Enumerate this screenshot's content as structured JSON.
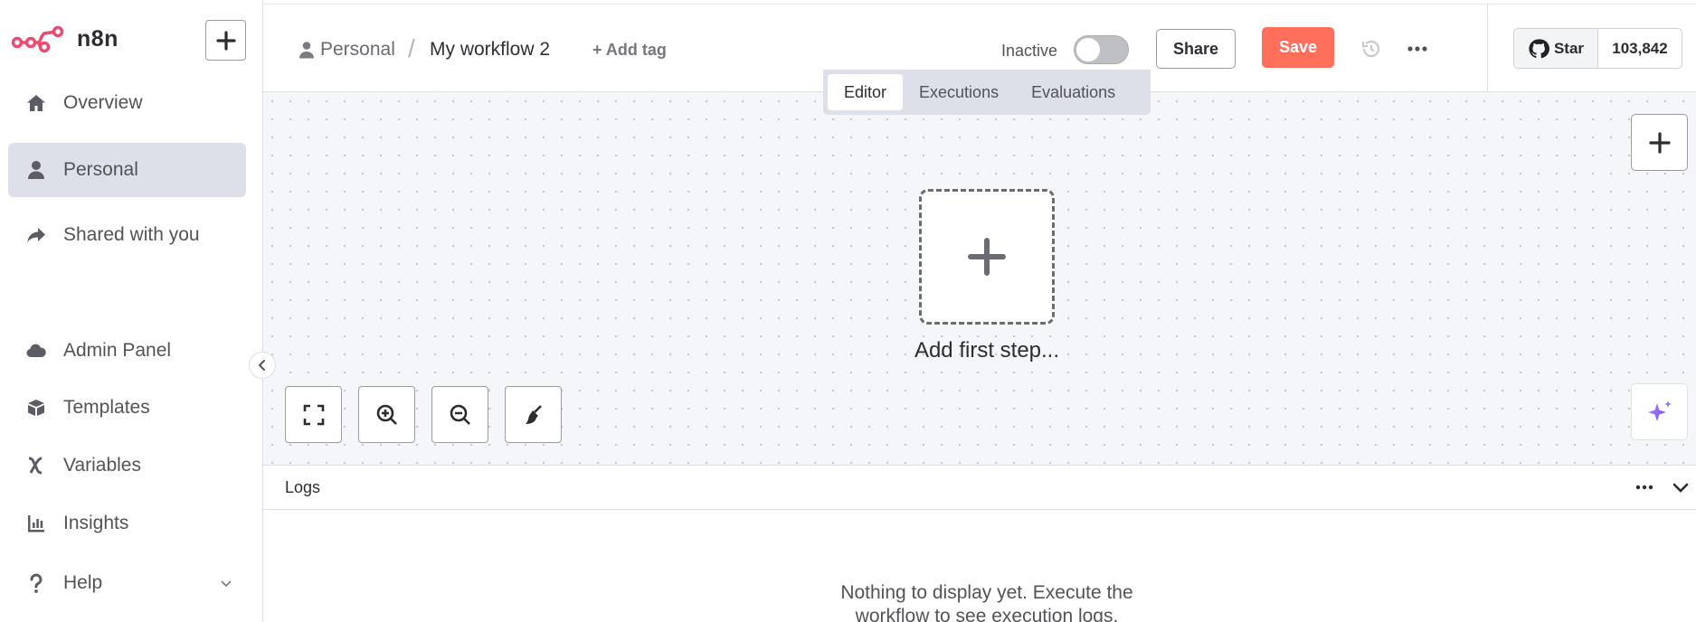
{
  "app": {
    "name": "n8n",
    "brand_color": "#ea4b71"
  },
  "sidebar": {
    "items": [
      {
        "label": "Overview",
        "icon": "home-icon"
      },
      {
        "label": "Personal",
        "icon": "user-icon",
        "active": true
      },
      {
        "label": "Shared with you",
        "icon": "share-icon"
      },
      {
        "label": "Admin Panel",
        "icon": "cloud-icon"
      },
      {
        "label": "Templates",
        "icon": "box-icon"
      },
      {
        "label": "Variables",
        "icon": "variable-icon"
      },
      {
        "label": "Insights",
        "icon": "chart-icon"
      },
      {
        "label": "Help",
        "icon": "question-icon"
      }
    ]
  },
  "header": {
    "breadcrumb_project": "Personal",
    "separator": "/",
    "workflow_name": "My workflow 2",
    "add_tag": "+ Add tag",
    "status_label": "Inactive",
    "active": false,
    "share_label": "Share",
    "save_label": "Save",
    "save_color": "#ff6f5c",
    "github_star_label": "Star",
    "github_star_count": "103,842"
  },
  "tabs": [
    {
      "label": "Editor",
      "active": true
    },
    {
      "label": "Executions",
      "active": false
    },
    {
      "label": "Evaluations",
      "active": false
    }
  ],
  "canvas": {
    "first_step_label": "Add first step..."
  },
  "logs": {
    "title": "Logs",
    "empty_message": "Nothing to display yet. Execute the workflow to see execution logs."
  }
}
